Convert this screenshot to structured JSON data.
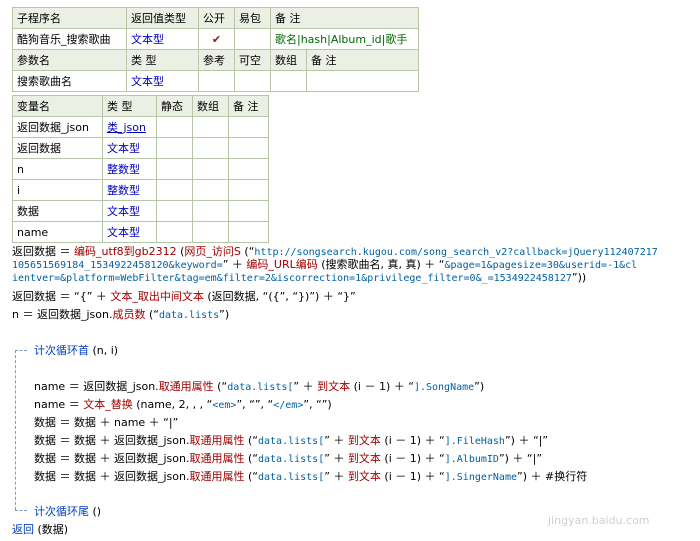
{
  "sub_table": {
    "headers": [
      "子程序名",
      "返回值类型",
      "公开",
      "易包",
      "备 注"
    ],
    "row": {
      "name": "酷狗音乐_搜索歌曲",
      "return_type": "文本型",
      "public_check": "✔",
      "remark": "歌名|hash|Album_id|歌手"
    },
    "param_headers": [
      "参数名",
      "类 型",
      "参考",
      "可空",
      "数组",
      "备 注"
    ],
    "param_row": {
      "name": "搜索歌曲名",
      "type": "文本型"
    }
  },
  "var_table": {
    "headers": [
      "变量名",
      "类 型",
      "静态",
      "数组",
      "备 注"
    ],
    "rows": [
      {
        "name": "返回数据_json",
        "type": "类_json"
      },
      {
        "name": "返回数据",
        "type": "文本型"
      },
      {
        "name": "n",
        "type": "整数型"
      },
      {
        "name": "i",
        "type": "整数型"
      },
      {
        "name": "数据",
        "type": "文本型"
      },
      {
        "name": "name",
        "type": "文本型"
      }
    ]
  },
  "code": {
    "l1a": "返回数据 ＝ ",
    "l1b": "编码_utf8到gb2312",
    "l1c": " (",
    "l1d": "网页_访问S",
    "l1e": " (“",
    "l1f": "http://songsearch.kugou.com/song_search_v2?callback=jQuery112407217",
    "l2a": "105651569184_1534922458120&keyword=",
    "l2b": "” ＋ ",
    "l2c": "编码_URL编码",
    "l2d": " (搜索歌曲名, 真, 真) ＋ “",
    "l2e": "&page=1&pagesize=30&userid=-1&cl",
    "l3a": "ientver=&platform=WebFilter&tag=em&filter=2&iscorrection=1&privilege_filter=0&_=1534922458127",
    "l3b": "”))",
    "l4a": "返回数据 ＝ “{” ＋ ",
    "l4b": "文本_取出中间文本",
    "l4c": " (返回数据, “({”, “})”) ＋ “}”",
    "l5a": "n ＝ 返回数据_json.",
    "l5b": "成员数",
    "l5c": " (“",
    "l5d": "data.lists",
    "l5e": "”)",
    "loop_start": "计次循环首",
    "loop_args": " (n, i)",
    "b1a": "name ＝ 返回数据_json.",
    "b1b": "取通用属性",
    "b1c": " (“",
    "b1d": "data.lists[",
    "b1e": "” ＋ ",
    "b1f": "到文本",
    "b1g": " (i － 1) ＋ “",
    "b1h": "].SongName",
    "b1i": "”)",
    "b2a": "name ＝ ",
    "b2b": "文本_替换",
    "b2c": " (name, 2, , , “",
    "b2d": "<em>",
    "b2e": "”, “”, “",
    "b2f": "</em>",
    "b2g": "”, “”)",
    "b3": "数据 ＝ 数据 ＋ name ＋ “|”",
    "b4a": "数据 ＝ 数据 ＋ 返回数据_json.",
    "b4b": "取通用属性",
    "b4c": " (“",
    "b4d": "data.lists[",
    "b4e": "” ＋ ",
    "b4f": "到文本",
    "b4g": " (i － 1) ＋ “",
    "b4h": "].FileHash",
    "b4i": "”) ＋ “|”",
    "b5h": "].AlbumID",
    "b5i": "”) ＋ “|”",
    "b6h": "].SingerName",
    "b6i": "”) ＋ #换行符",
    "loop_end": "计次循环尾",
    "loop_end_args": " ()",
    "ret_a": "返回",
    "ret_b": " (数据)"
  },
  "watermark": "jingyan.baidu.com"
}
